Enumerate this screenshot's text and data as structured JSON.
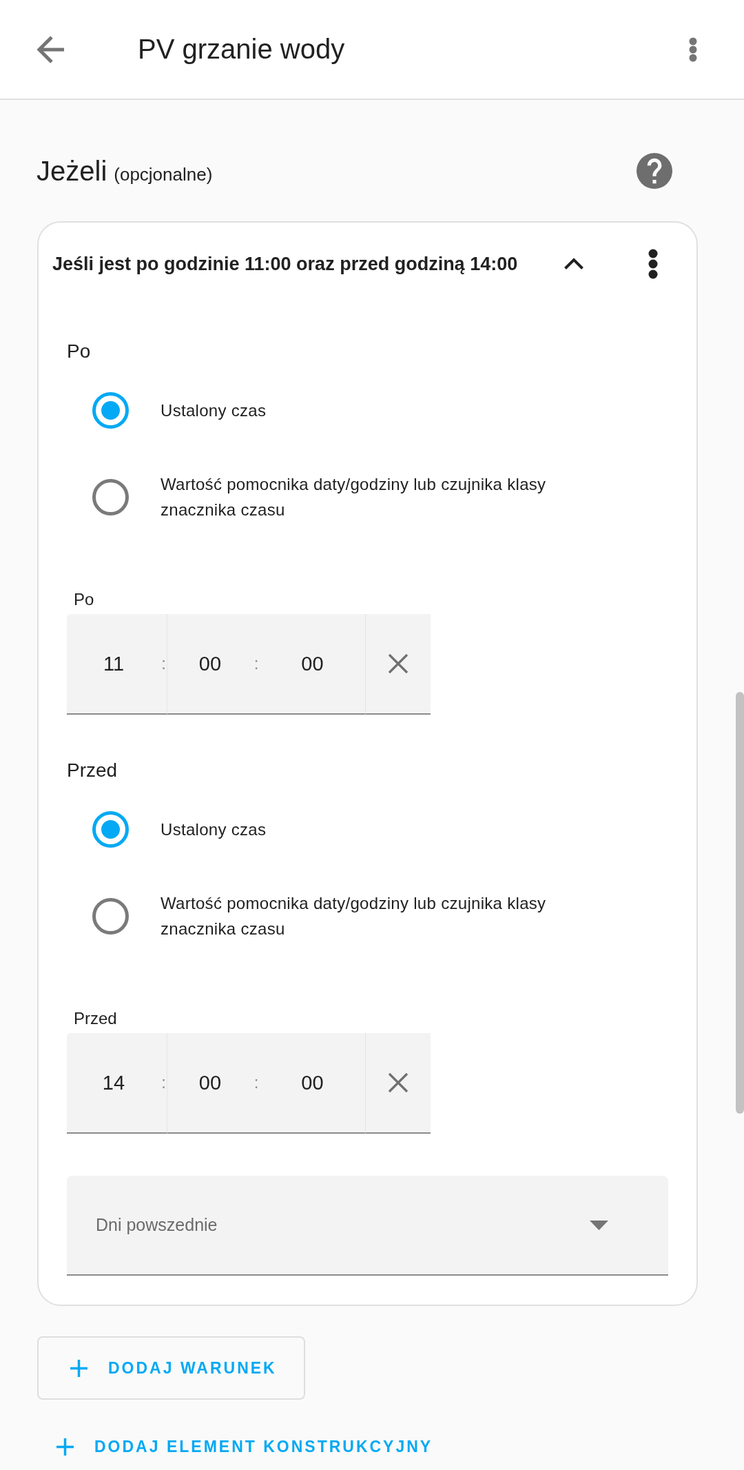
{
  "app_bar": {
    "title": "PV grzanie wody"
  },
  "section": {
    "title": "Jeżeli",
    "note": "(opcjonalne)"
  },
  "condition_card": {
    "title": "Jeśli jest po godzinie 11:00 oraz przed godziną 14:00",
    "expanded": true,
    "groups": [
      {
        "heading": "Po",
        "options": [
          {
            "label": "Ustalony czas",
            "selected": true
          },
          {
            "label": "Wartość pomocnika daty/godziny lub czujnika klasy znacznika czasu",
            "selected": false
          }
        ],
        "time_field": {
          "label": "Po",
          "hours": "11",
          "minutes": "00",
          "seconds": "00",
          "separators": [
            ":",
            ":"
          ]
        }
      },
      {
        "heading": "Przed",
        "options": [
          {
            "label": "Ustalony czas",
            "selected": true
          },
          {
            "label": "Wartość pomocnika daty/godziny lub czujnika klasy znacznika czasu",
            "selected": false
          }
        ],
        "time_field": {
          "label": "Przed",
          "hours": "14",
          "minutes": "00",
          "seconds": "00",
          "separators": [
            ":",
            ":"
          ]
        }
      }
    ],
    "weekday_select": {
      "label": "Dni powszednie"
    }
  },
  "buttons": [
    {
      "label": "DODAJ WARUNEK",
      "kind": "outlined"
    },
    {
      "label": "DODAJ ELEMENT KONSTRUKCYJNY",
      "kind": "text"
    }
  ]
}
